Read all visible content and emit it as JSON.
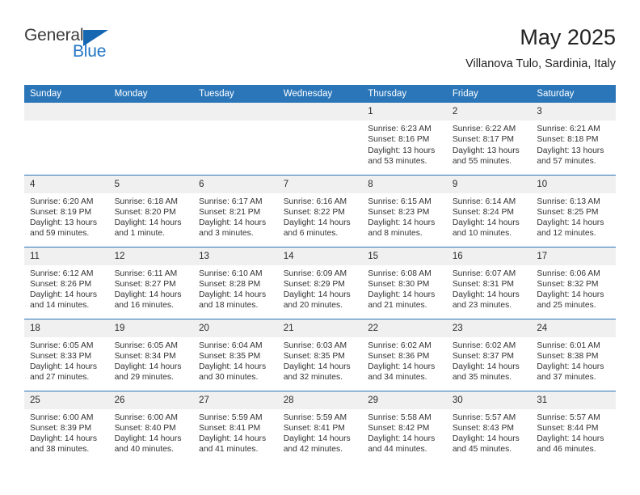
{
  "brand": {
    "name_part1": "General",
    "name_part2": "Blue",
    "flag_color": "#1567b2",
    "text_color": "#3b3b3b"
  },
  "header": {
    "title": "May 2025",
    "subtitle": "Villanova Tulo, Sardinia, Italy"
  },
  "theme": {
    "header_blue": "#2b76b9",
    "daynum_gray": "#f0f0f0",
    "text": "#333333"
  },
  "calendar": {
    "weekdays": [
      "Sunday",
      "Monday",
      "Tuesday",
      "Wednesday",
      "Thursday",
      "Friday",
      "Saturday"
    ],
    "labels": {
      "sunrise": "Sunrise:",
      "sunset": "Sunset:",
      "daylight": "Daylight:"
    },
    "weeks": [
      [
        {
          "day": "",
          "empty": true
        },
        {
          "day": "",
          "empty": true
        },
        {
          "day": "",
          "empty": true
        },
        {
          "day": "",
          "empty": true
        },
        {
          "day": "1",
          "sunrise": "Sunrise: 6:23 AM",
          "sunset": "Sunset: 8:16 PM",
          "daylight1": "Daylight: 13 hours",
          "daylight2": "and 53 minutes."
        },
        {
          "day": "2",
          "sunrise": "Sunrise: 6:22 AM",
          "sunset": "Sunset: 8:17 PM",
          "daylight1": "Daylight: 13 hours",
          "daylight2": "and 55 minutes."
        },
        {
          "day": "3",
          "sunrise": "Sunrise: 6:21 AM",
          "sunset": "Sunset: 8:18 PM",
          "daylight1": "Daylight: 13 hours",
          "daylight2": "and 57 minutes."
        }
      ],
      [
        {
          "day": "4",
          "sunrise": "Sunrise: 6:20 AM",
          "sunset": "Sunset: 8:19 PM",
          "daylight1": "Daylight: 13 hours",
          "daylight2": "and 59 minutes."
        },
        {
          "day": "5",
          "sunrise": "Sunrise: 6:18 AM",
          "sunset": "Sunset: 8:20 PM",
          "daylight1": "Daylight: 14 hours",
          "daylight2": "and 1 minute."
        },
        {
          "day": "6",
          "sunrise": "Sunrise: 6:17 AM",
          "sunset": "Sunset: 8:21 PM",
          "daylight1": "Daylight: 14 hours",
          "daylight2": "and 3 minutes."
        },
        {
          "day": "7",
          "sunrise": "Sunrise: 6:16 AM",
          "sunset": "Sunset: 8:22 PM",
          "daylight1": "Daylight: 14 hours",
          "daylight2": "and 6 minutes."
        },
        {
          "day": "8",
          "sunrise": "Sunrise: 6:15 AM",
          "sunset": "Sunset: 8:23 PM",
          "daylight1": "Daylight: 14 hours",
          "daylight2": "and 8 minutes."
        },
        {
          "day": "9",
          "sunrise": "Sunrise: 6:14 AM",
          "sunset": "Sunset: 8:24 PM",
          "daylight1": "Daylight: 14 hours",
          "daylight2": "and 10 minutes."
        },
        {
          "day": "10",
          "sunrise": "Sunrise: 6:13 AM",
          "sunset": "Sunset: 8:25 PM",
          "daylight1": "Daylight: 14 hours",
          "daylight2": "and 12 minutes."
        }
      ],
      [
        {
          "day": "11",
          "sunrise": "Sunrise: 6:12 AM",
          "sunset": "Sunset: 8:26 PM",
          "daylight1": "Daylight: 14 hours",
          "daylight2": "and 14 minutes."
        },
        {
          "day": "12",
          "sunrise": "Sunrise: 6:11 AM",
          "sunset": "Sunset: 8:27 PM",
          "daylight1": "Daylight: 14 hours",
          "daylight2": "and 16 minutes."
        },
        {
          "day": "13",
          "sunrise": "Sunrise: 6:10 AM",
          "sunset": "Sunset: 8:28 PM",
          "daylight1": "Daylight: 14 hours",
          "daylight2": "and 18 minutes."
        },
        {
          "day": "14",
          "sunrise": "Sunrise: 6:09 AM",
          "sunset": "Sunset: 8:29 PM",
          "daylight1": "Daylight: 14 hours",
          "daylight2": "and 20 minutes."
        },
        {
          "day": "15",
          "sunrise": "Sunrise: 6:08 AM",
          "sunset": "Sunset: 8:30 PM",
          "daylight1": "Daylight: 14 hours",
          "daylight2": "and 21 minutes."
        },
        {
          "day": "16",
          "sunrise": "Sunrise: 6:07 AM",
          "sunset": "Sunset: 8:31 PM",
          "daylight1": "Daylight: 14 hours",
          "daylight2": "and 23 minutes."
        },
        {
          "day": "17",
          "sunrise": "Sunrise: 6:06 AM",
          "sunset": "Sunset: 8:32 PM",
          "daylight1": "Daylight: 14 hours",
          "daylight2": "and 25 minutes."
        }
      ],
      [
        {
          "day": "18",
          "sunrise": "Sunrise: 6:05 AM",
          "sunset": "Sunset: 8:33 PM",
          "daylight1": "Daylight: 14 hours",
          "daylight2": "and 27 minutes."
        },
        {
          "day": "19",
          "sunrise": "Sunrise: 6:05 AM",
          "sunset": "Sunset: 8:34 PM",
          "daylight1": "Daylight: 14 hours",
          "daylight2": "and 29 minutes."
        },
        {
          "day": "20",
          "sunrise": "Sunrise: 6:04 AM",
          "sunset": "Sunset: 8:35 PM",
          "daylight1": "Daylight: 14 hours",
          "daylight2": "and 30 minutes."
        },
        {
          "day": "21",
          "sunrise": "Sunrise: 6:03 AM",
          "sunset": "Sunset: 8:35 PM",
          "daylight1": "Daylight: 14 hours",
          "daylight2": "and 32 minutes."
        },
        {
          "day": "22",
          "sunrise": "Sunrise: 6:02 AM",
          "sunset": "Sunset: 8:36 PM",
          "daylight1": "Daylight: 14 hours",
          "daylight2": "and 34 minutes."
        },
        {
          "day": "23",
          "sunrise": "Sunrise: 6:02 AM",
          "sunset": "Sunset: 8:37 PM",
          "daylight1": "Daylight: 14 hours",
          "daylight2": "and 35 minutes."
        },
        {
          "day": "24",
          "sunrise": "Sunrise: 6:01 AM",
          "sunset": "Sunset: 8:38 PM",
          "daylight1": "Daylight: 14 hours",
          "daylight2": "and 37 minutes."
        }
      ],
      [
        {
          "day": "25",
          "sunrise": "Sunrise: 6:00 AM",
          "sunset": "Sunset: 8:39 PM",
          "daylight1": "Daylight: 14 hours",
          "daylight2": "and 38 minutes."
        },
        {
          "day": "26",
          "sunrise": "Sunrise: 6:00 AM",
          "sunset": "Sunset: 8:40 PM",
          "daylight1": "Daylight: 14 hours",
          "daylight2": "and 40 minutes."
        },
        {
          "day": "27",
          "sunrise": "Sunrise: 5:59 AM",
          "sunset": "Sunset: 8:41 PM",
          "daylight1": "Daylight: 14 hours",
          "daylight2": "and 41 minutes."
        },
        {
          "day": "28",
          "sunrise": "Sunrise: 5:59 AM",
          "sunset": "Sunset: 8:41 PM",
          "daylight1": "Daylight: 14 hours",
          "daylight2": "and 42 minutes."
        },
        {
          "day": "29",
          "sunrise": "Sunrise: 5:58 AM",
          "sunset": "Sunset: 8:42 PM",
          "daylight1": "Daylight: 14 hours",
          "daylight2": "and 44 minutes."
        },
        {
          "day": "30",
          "sunrise": "Sunrise: 5:57 AM",
          "sunset": "Sunset: 8:43 PM",
          "daylight1": "Daylight: 14 hours",
          "daylight2": "and 45 minutes."
        },
        {
          "day": "31",
          "sunrise": "Sunrise: 5:57 AM",
          "sunset": "Sunset: 8:44 PM",
          "daylight1": "Daylight: 14 hours",
          "daylight2": "and 46 minutes."
        }
      ]
    ]
  }
}
